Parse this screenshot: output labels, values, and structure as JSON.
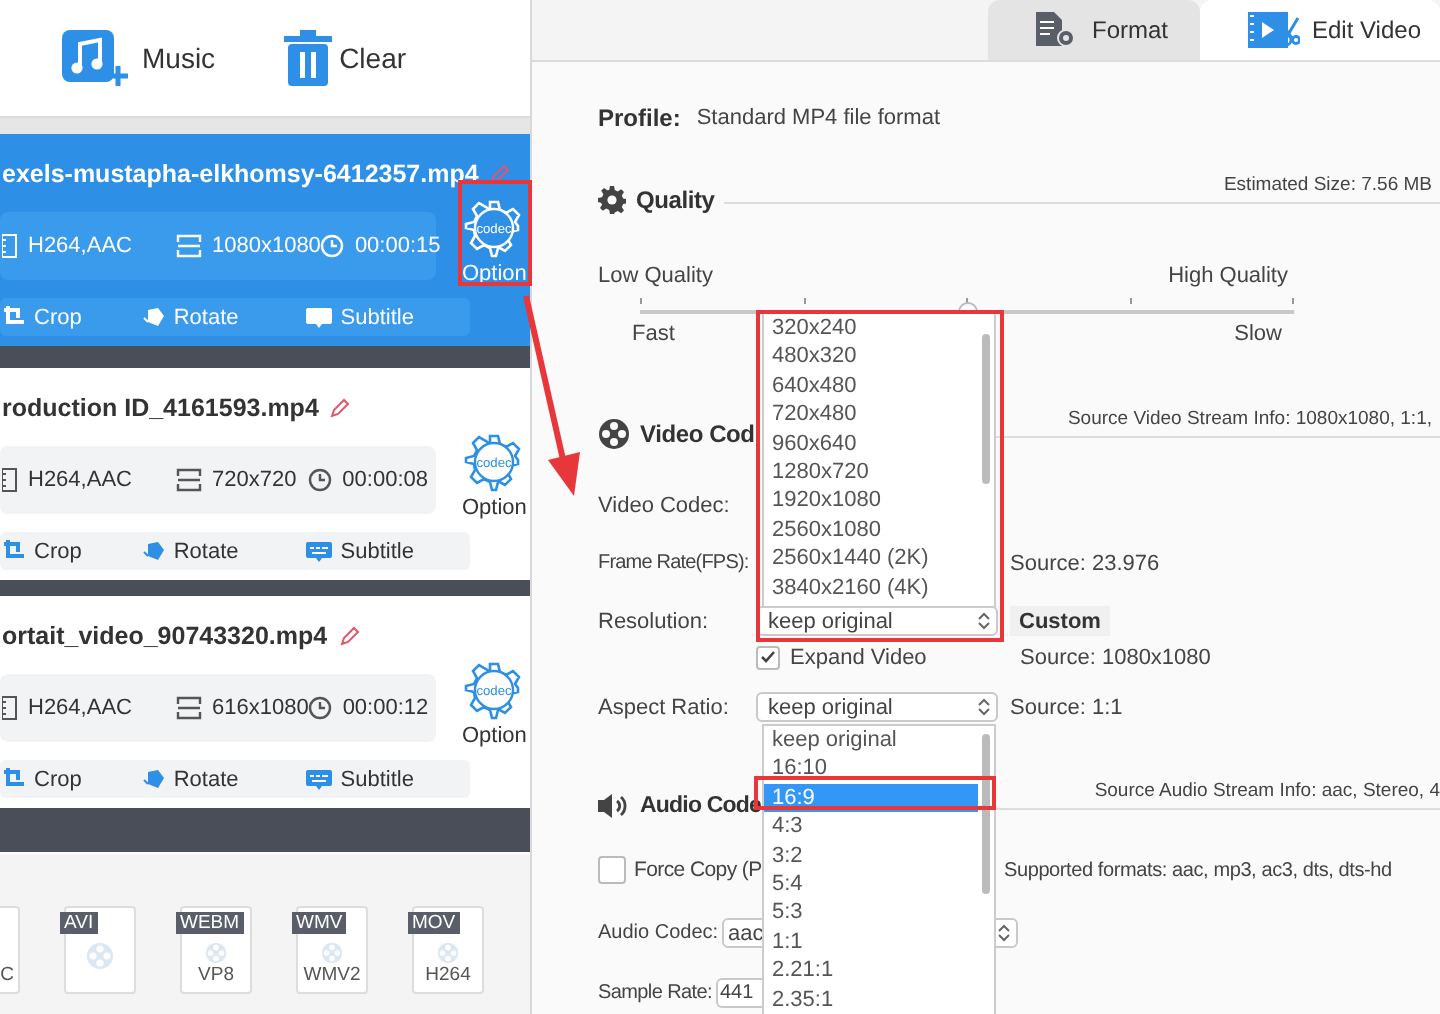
{
  "toolbar": {
    "buttons": [
      {
        "kind": "music",
        "label": "Music"
      },
      {
        "kind": "clear",
        "label": "Clear"
      }
    ]
  },
  "videos": [
    {
      "name": "exels-mustapha-elkhomsy-6412357.mp4",
      "selected": true,
      "codec": "H264,AAC",
      "resolution": "1080x1080",
      "duration": "00:00:15",
      "option_badge": "codec",
      "option_label": "Option",
      "actions": [
        "Crop",
        "Rotate",
        "Subtitle"
      ]
    },
    {
      "name": "roduction ID_4161593.mp4",
      "selected": false,
      "codec": "H264,AAC",
      "resolution": "720x720",
      "duration": "00:00:08",
      "option_badge": "codec",
      "option_label": "Option",
      "actions": [
        "Crop",
        "Rotate",
        "Subtitle"
      ]
    },
    {
      "name": "ortait_video_90743320.mp4",
      "selected": false,
      "codec": "H264,AAC",
      "resolution": "616x1080",
      "duration": "00:00:12",
      "option_badge": "codec",
      "option_label": "Option",
      "actions": [
        "Crop",
        "Rotate",
        "Subtitle"
      ]
    }
  ],
  "formats": [
    {
      "kind": "partial",
      "codec": "C"
    },
    {
      "kind": "tile",
      "tag": "AVI"
    },
    {
      "kind": "tile",
      "tag": "WEBM",
      "codec": "VP8"
    },
    {
      "kind": "tile",
      "tag": "WMV",
      "codec": "WMV2"
    },
    {
      "kind": "tile",
      "tag": "MOV",
      "codec": "H264"
    }
  ],
  "tabs": [
    {
      "kind": "format",
      "label": "Format",
      "selected": true
    },
    {
      "kind": "edit",
      "label": "Edit Video",
      "selected": false
    }
  ],
  "profile": {
    "label": "Profile:",
    "value": "Standard MP4 file format"
  },
  "quality": {
    "title": "Quality",
    "estimated": "Estimated Size: 7.56 MB",
    "low": "Low Quality",
    "high": "High Quality",
    "fast": "Fast",
    "slow": "Slow",
    "level": 0.5
  },
  "video_codec": {
    "title": "Video Cod",
    "stream_info": "Source Video Stream Info: 1080x1080, 1:1,",
    "codec_label": "Video Codec:",
    "fps_label": "Frame Rate(FPS):",
    "fps_source": "Source: 23.976",
    "resolution_label": "Resolution:",
    "resolution_value": "keep original",
    "custom_button": "Custom",
    "expand": {
      "label": "Expand Video",
      "checked": true
    },
    "resolution_source": "Source: 1080x1080",
    "aspect_label": "Aspect Ratio:",
    "aspect_value": "keep original",
    "aspect_source": "Source: 1:1"
  },
  "resolution_list": [
    {
      "label": "320x240",
      "selected": false
    },
    {
      "label": "480x320",
      "selected": false
    },
    {
      "label": "640x480",
      "selected": false
    },
    {
      "label": "720x480",
      "selected": false
    },
    {
      "label": "960x640",
      "selected": false
    },
    {
      "label": "1280x720",
      "selected": false
    },
    {
      "label": "1920x1080",
      "selected": false
    },
    {
      "label": "2560x1080",
      "selected": false
    },
    {
      "label": "2560x1440 (2K)",
      "selected": false
    },
    {
      "label": "3840x2160 (4K)",
      "selected": false
    }
  ],
  "aspect_list": [
    {
      "label": "keep original",
      "selected": false
    },
    {
      "label": "16:10",
      "selected": false
    },
    {
      "label": "16:9",
      "selected": true
    },
    {
      "label": "4:3",
      "selected": false
    },
    {
      "label": "3:2",
      "selected": false
    },
    {
      "label": "5:4",
      "selected": false
    },
    {
      "label": "5:3",
      "selected": false
    },
    {
      "label": "1:1",
      "selected": false
    },
    {
      "label": "2.21:1",
      "selected": false
    },
    {
      "label": "2.35:1",
      "selected": false
    }
  ],
  "audio_codec": {
    "title": "Audio Code",
    "stream_info": "Source Audio Stream Info: aac, Stereo, 4",
    "force_copy": {
      "label": "Force Copy (P",
      "checked": false
    },
    "supported": "Supported formats: aac, mp3, ac3, dts, dts-hd",
    "codec_label": "Audio Codec:",
    "codec_value": "aac",
    "rate_label": "Sample Rate:",
    "rate_value": "441"
  }
}
